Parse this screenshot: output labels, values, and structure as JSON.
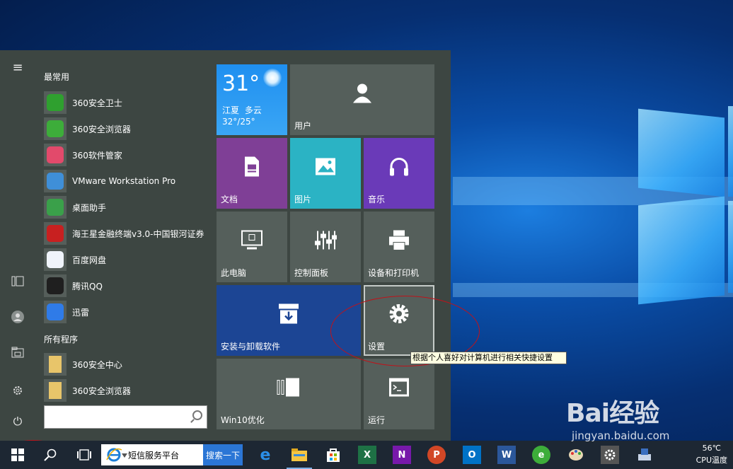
{
  "start_menu": {
    "rail": {
      "hamburger": "≡",
      "power": "⏻"
    },
    "groups": {
      "most_used": "最常用",
      "all_programs": "所有程序"
    },
    "most_used": [
      {
        "label": "360安全卫士",
        "icon": "360-safe-icon"
      },
      {
        "label": "360安全浏览器",
        "icon": "360-browser-icon"
      },
      {
        "label": "360软件管家",
        "icon": "360-software-manager-icon"
      },
      {
        "label": "VMware Workstation Pro",
        "icon": "vmware-icon"
      },
      {
        "label": "桌面助手",
        "icon": "desktop-assistant-icon"
      },
      {
        "label": "海王星金融终端v3.0-中国银河证券",
        "icon": "finance-terminal-icon"
      },
      {
        "label": "百度网盘",
        "icon": "baidu-netdisk-icon"
      },
      {
        "label": "腾讯QQ",
        "icon": "qq-icon"
      },
      {
        "label": "迅雷",
        "icon": "xunlei-icon"
      }
    ],
    "all_programs": [
      {
        "label": "360安全中心",
        "icon": "folder-icon"
      },
      {
        "label": "360安全浏览器",
        "icon": "folder-icon"
      }
    ],
    "search": {
      "placeholder": ""
    }
  },
  "tiles": {
    "weather": {
      "temp": "31°",
      "location": "江夏",
      "condition": "多云",
      "range": "32°/25°"
    },
    "user": "用户",
    "documents": "文档",
    "pictures": "图片",
    "music": "音乐",
    "this_pc": "此电脑",
    "control_panel": "控制面板",
    "devices_printers": "设备和打印机",
    "install_uninstall": "安装与卸载软件",
    "settings": "设置",
    "win10_optimize": "Win10优化",
    "run": "运行"
  },
  "tooltip": "根据个人喜好对计算机进行相关快捷设置",
  "taskbar": {
    "ie_search_text": "短信服务平台",
    "ie_search_button": "搜索一下",
    "temperature": "56℃",
    "temperature_label": "CPU温度"
  },
  "watermark": {
    "brand": "Bai经验",
    "url": "jingyan.baidu.com"
  },
  "colors": {
    "start_bg": "#3d4642",
    "tile_gray": "#555f5b",
    "weather_blue": "#2a9df4",
    "docs_purple": "#7f3f96",
    "pictures_teal": "#2bb3c4",
    "music_violet": "#6a3ab8",
    "install_navy": "#1c4594",
    "annotation_red": "#c0121a"
  }
}
